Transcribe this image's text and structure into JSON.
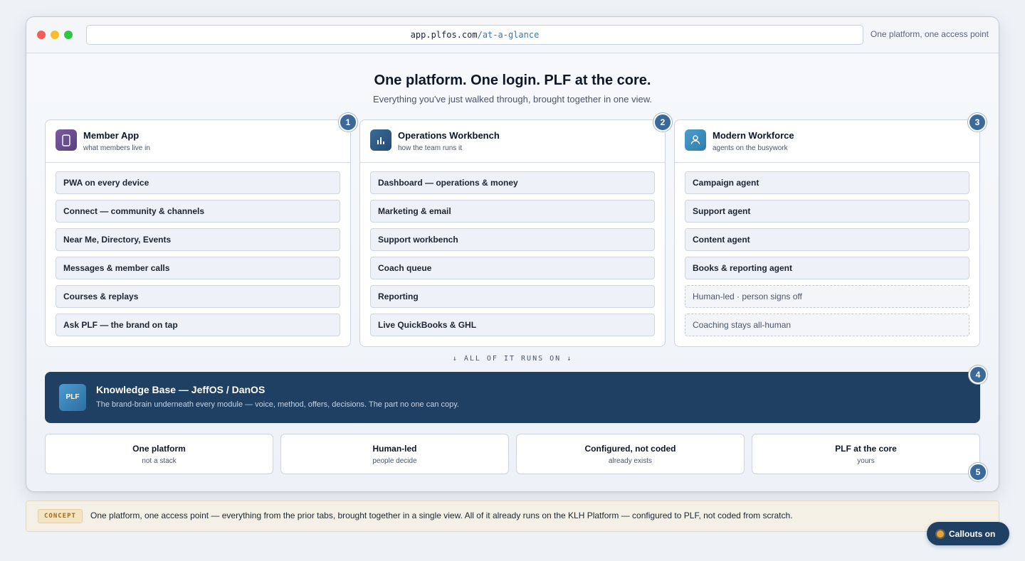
{
  "browser": {
    "domain": "app.plfos.com",
    "path": "/at-a-glance",
    "right_label": "One platform, one access point"
  },
  "page": {
    "title": "One platform. One login. PLF at the core.",
    "subtitle": "Everything you've just walked through, brought together in one view."
  },
  "columns": [
    {
      "title": "Member App",
      "subtitle": "what members live in",
      "icon": "phone-icon",
      "badge": "1",
      "items": [
        "PWA on every device",
        "Connect — community & channels",
        "Near Me, Directory, Events",
        "Messages & member calls",
        "Courses & replays",
        "Ask PLF — the brand on tap"
      ]
    },
    {
      "title": "Operations Workbench",
      "subtitle": "how the team runs it",
      "icon": "bar-chart-icon",
      "badge": "2",
      "items": [
        "Dashboard — operations & money",
        "Marketing & email",
        "Support workbench",
        "Coach queue",
        "Reporting",
        "Live QuickBooks & GHL"
      ]
    },
    {
      "title": "Modern Workforce",
      "subtitle": "agents on the busywork",
      "icon": "person-icon",
      "badge": "3",
      "items": [
        "Campaign agent",
        "Support agent",
        "Content agent",
        "Books & reporting agent",
        "Human-led · person signs off",
        "Coaching stays all-human"
      ]
    }
  ],
  "runs_on": "↓  ALL OF IT RUNS ON  ↓",
  "knowledge_base": {
    "icon_label": "PLF",
    "title": "Knowledge Base — JeffOS / DanOS",
    "description": "The brand-brain underneath every module — voice, method, offers, decisions. The part no one can copy.",
    "badge": "4"
  },
  "pillars": [
    {
      "title": "One platform",
      "subtitle": "not a stack"
    },
    {
      "title": "Human-led",
      "subtitle": "people decide"
    },
    {
      "title": "Configured, not coded",
      "subtitle": "already exists"
    },
    {
      "title": "PLF at the core",
      "subtitle": "yours"
    }
  ],
  "pillars_badge": "5",
  "concept": {
    "tag": "CONCEPT",
    "text": "One platform, one access point — everything from the prior tabs, brought together in a single view. All of it already runs on the KLH Platform — configured to PLF, not coded from scratch."
  },
  "callouts_button": "Callouts on",
  "colors": {
    "member_icon": "#6a4d8f",
    "ops_icon": "#2f5d8a",
    "workforce_icon": "#3f8fbe",
    "kb_background": "#1f3f63",
    "badge": "#3b6a9a",
    "accent": "#e4a23a"
  }
}
